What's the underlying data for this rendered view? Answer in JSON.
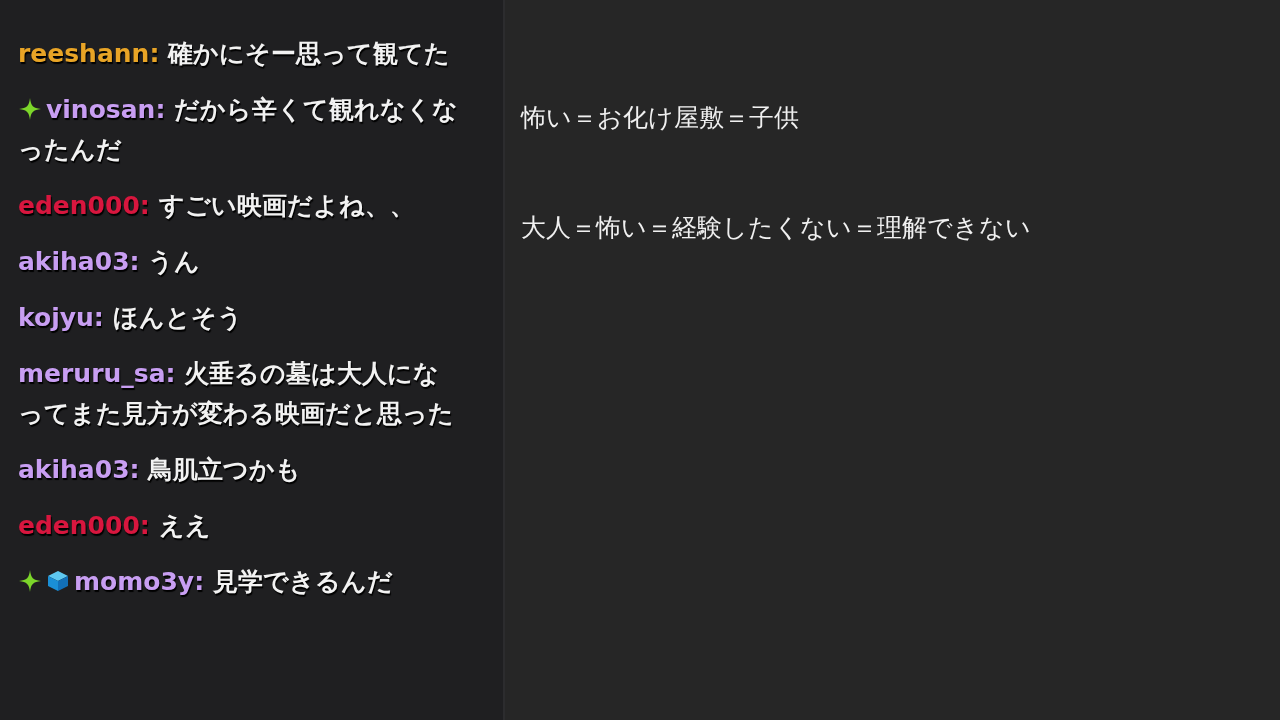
{
  "chat": {
    "messages": [
      {
        "user": "reeshann:",
        "color": "#e8a426",
        "text": "確かにそー思って観てた"
      },
      {
        "user": "vinosan:",
        "color": "#c89ef2",
        "badges": [
          {
            "kind": "sparkle"
          }
        ],
        "text": "だから辛くて観れなくなったんだ"
      },
      {
        "user": "eden000:",
        "color": "#d8163e",
        "text": "すごい映画だよね、、"
      },
      {
        "user": "akiha03:",
        "color": "#c89ef2",
        "text": "うん"
      },
      {
        "user": "kojyu:",
        "color": "#c89ef2",
        "text": "ほんとそう"
      },
      {
        "user": "meruru_sa:",
        "color": "#c89ef2",
        "text": "火垂るの墓は大人になってまた見方が変わる映画だと思った"
      },
      {
        "user": "akiha03:",
        "color": "#c89ef2",
        "text": "鳥肌立つかも"
      },
      {
        "user": "eden000:",
        "color": "#d8163e",
        "text": "ええ"
      },
      {
        "user": "momo3y:",
        "color": "#c89ef2",
        "badges": [
          {
            "kind": "sparkle"
          },
          {
            "kind": "cube"
          }
        ],
        "text": "見学できるんだ"
      }
    ]
  },
  "notes": [
    "怖い＝お化け屋敷＝子供",
    "大人＝怖い＝経験したくない＝理解できない"
  ]
}
